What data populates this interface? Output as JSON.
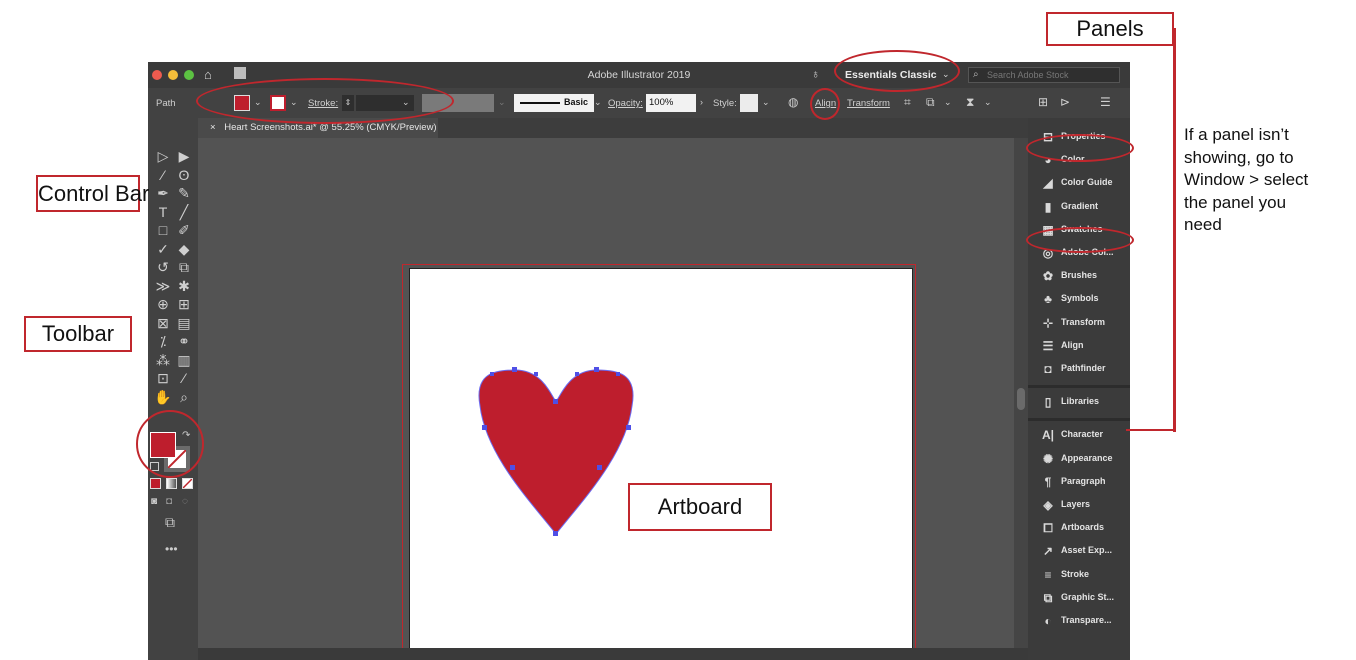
{
  "window": {
    "title": "Adobe Illustrator 2019",
    "workspace": "Essentials Classic",
    "search_placeholder": "Search Adobe Stock"
  },
  "control_bar": {
    "selection_type": "Path",
    "stroke_label": "Stroke:",
    "brush_label": "Basic",
    "opacity_label": "Opacity:",
    "opacity_value": "100%",
    "style_label": "Style:",
    "align_label": "Align",
    "transform_label": "Transform"
  },
  "document_tab": {
    "close": "×",
    "label": "Heart Screenshots.ai* @ 55.25% (CMYK/Preview)"
  },
  "colors": {
    "fill": "#be1e2d",
    "accent": "#c0272d"
  },
  "tools": [
    {
      "icon": "selection-tool-icon",
      "glyph": "▷"
    },
    {
      "icon": "direct-selection-tool-icon",
      "glyph": "▶"
    },
    {
      "icon": "magic-wand-tool-icon",
      "glyph": "⁄"
    },
    {
      "icon": "lasso-tool-icon",
      "glyph": "ʘ"
    },
    {
      "icon": "pen-tool-icon",
      "glyph": "✒"
    },
    {
      "icon": "curvature-tool-icon",
      "glyph": "✎"
    },
    {
      "icon": "type-tool-icon",
      "glyph": "T"
    },
    {
      "icon": "line-tool-icon",
      "glyph": "╱"
    },
    {
      "icon": "rectangle-tool-icon",
      "glyph": "□"
    },
    {
      "icon": "paintbrush-tool-icon",
      "glyph": "✐"
    },
    {
      "icon": "shaper-tool-icon",
      "glyph": "✓"
    },
    {
      "icon": "eraser-tool-icon",
      "glyph": "◆"
    },
    {
      "icon": "rotate-tool-icon",
      "glyph": "↺"
    },
    {
      "icon": "scale-tool-icon",
      "glyph": "⧉"
    },
    {
      "icon": "width-tool-icon",
      "glyph": "≫"
    },
    {
      "icon": "puppet-warp-tool-icon",
      "glyph": "✱"
    },
    {
      "icon": "shape-builder-tool-icon",
      "glyph": "⊕"
    },
    {
      "icon": "perspective-grid-tool-icon",
      "glyph": "⊞"
    },
    {
      "icon": "mesh-tool-icon",
      "glyph": "⊠"
    },
    {
      "icon": "gradient-tool-icon",
      "glyph": "▤"
    },
    {
      "icon": "eyedropper-tool-icon",
      "glyph": "⁒"
    },
    {
      "icon": "blend-tool-icon",
      "glyph": "⚭"
    },
    {
      "icon": "symbol-sprayer-tool-icon",
      "glyph": "⁂"
    },
    {
      "icon": "column-graph-tool-icon",
      "glyph": "▥"
    },
    {
      "icon": "artboard-tool-icon",
      "glyph": "⊡"
    },
    {
      "icon": "slice-tool-icon",
      "glyph": "⁄"
    },
    {
      "icon": "hand-tool-icon",
      "glyph": "✋"
    },
    {
      "icon": "zoom-tool-icon",
      "glyph": "⌕"
    }
  ],
  "panels_group1": [
    {
      "label": "Properties",
      "icon": "properties-icon",
      "glyph": "⊟"
    },
    {
      "label": "Color",
      "icon": "color-icon",
      "glyph": "◕"
    },
    {
      "label": "Color Guide",
      "icon": "color-guide-icon",
      "glyph": "◢"
    },
    {
      "label": "Gradient",
      "icon": "gradient-icon",
      "glyph": "▮"
    },
    {
      "label": "Swatches",
      "icon": "swatches-icon",
      "glyph": "▦"
    },
    {
      "label": "Adobe Col...",
      "icon": "adobe-color-themes-icon",
      "glyph": "◎"
    },
    {
      "label": "Brushes",
      "icon": "brushes-icon",
      "glyph": "✿"
    },
    {
      "label": "Symbols",
      "icon": "symbols-icon",
      "glyph": "♣"
    },
    {
      "label": "Transform",
      "icon": "transform-icon",
      "glyph": "⊹"
    },
    {
      "label": "Align",
      "icon": "align-icon",
      "glyph": "☰"
    },
    {
      "label": "Pathfinder",
      "icon": "pathfinder-icon",
      "glyph": "◘"
    }
  ],
  "panels_group2": [
    {
      "label": "Libraries",
      "icon": "libraries-icon",
      "glyph": "▯"
    }
  ],
  "panels_group3": [
    {
      "label": "Character",
      "icon": "character-icon",
      "glyph": "A|"
    },
    {
      "label": "Appearance",
      "icon": "appearance-icon",
      "glyph": "✺"
    },
    {
      "label": "Paragraph",
      "icon": "paragraph-icon",
      "glyph": "¶"
    },
    {
      "label": "Layers",
      "icon": "layers-icon",
      "glyph": "◈"
    },
    {
      "label": "Artboards",
      "icon": "artboards-icon",
      "glyph": "⧠"
    },
    {
      "label": "Asset Exp...",
      "icon": "asset-export-icon",
      "glyph": "↗"
    },
    {
      "label": "Stroke",
      "icon": "stroke-icon",
      "glyph": "≡"
    },
    {
      "label": "Graphic St...",
      "icon": "graphic-styles-icon",
      "glyph": "⧉"
    },
    {
      "label": "Transpare...",
      "icon": "transparency-icon",
      "glyph": "◐"
    }
  ],
  "annotations": {
    "panels": "Panels",
    "control_bar": "Control Bar",
    "toolbar": "Toolbar",
    "artboard": "Artboard",
    "panel_note": [
      "If a panel isn’t",
      "showing, go to",
      "Window > select",
      "the panel you",
      "need"
    ]
  }
}
